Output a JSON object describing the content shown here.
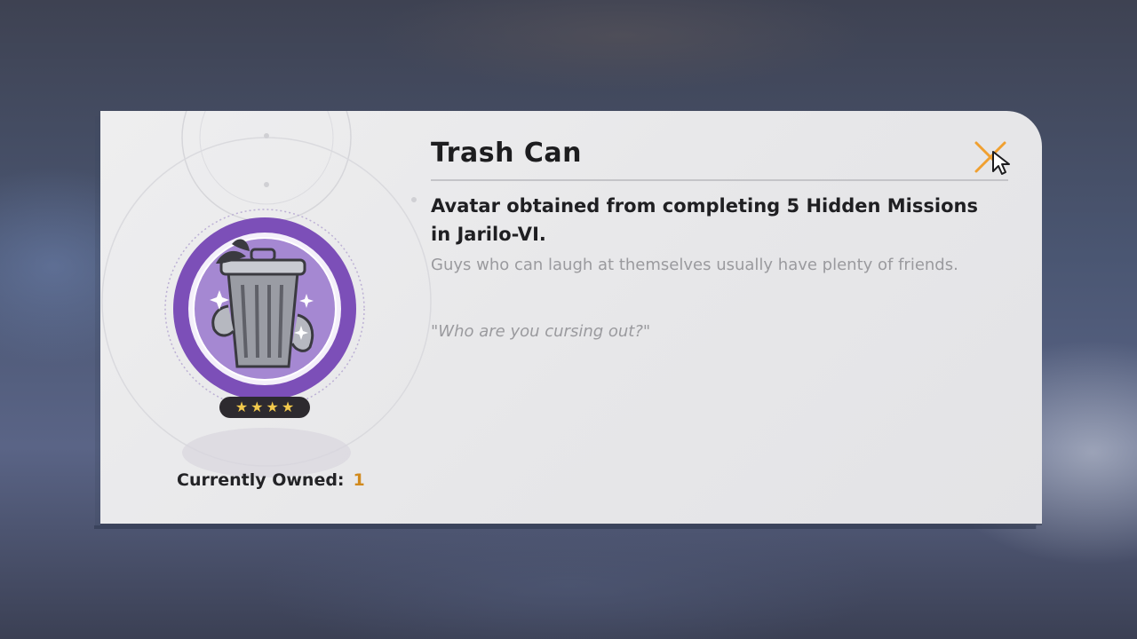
{
  "item": {
    "title": "Trash Can",
    "description": "Avatar obtained from completing 5 Hidden Missions in Jarilo-VI.",
    "flavor_text": "Guys who can laugh at themselves usually have plenty of friends.",
    "quote": "\"Who are you cursing out?\"",
    "rarity_stars": 4,
    "owned_label": "Currently Owned:",
    "owned_count": "1"
  },
  "icons": {
    "close": "close-x-icon",
    "avatar": "trash-can-avatar-icon",
    "cursor": "mouse-cursor-icon"
  },
  "colors": {
    "accent_purple": "#7c4fb8",
    "close_orange": "#f0a030",
    "owned_value": "#d18a1e",
    "star_gold": "#f2c94c"
  }
}
